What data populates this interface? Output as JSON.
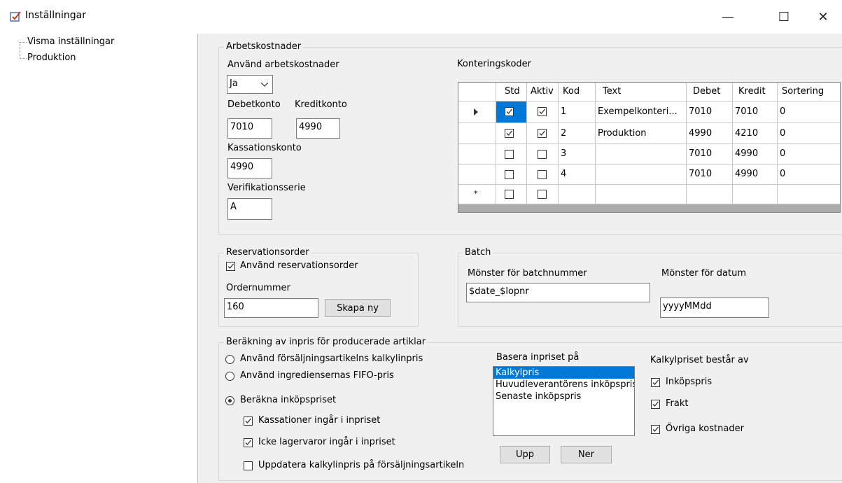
{
  "window": {
    "title": "Inställningar",
    "minimize": "—",
    "maximize": "☐",
    "close": "✕"
  },
  "tree": {
    "items": [
      {
        "label": "Visma inställningar"
      },
      {
        "label": "Produktion"
      }
    ]
  },
  "arbetskostnader": {
    "group_label": "Arbetskostnader",
    "use_label": "Använd arbetskostnader",
    "use_value": "Ja",
    "debet_label": "Debetkonto",
    "kredit_label": "Kreditkonto",
    "debet_value": "7010",
    "kredit_value": "4990",
    "kassation_label": "Kassationskonto",
    "kassation_value": "4990",
    "verif_label": "Verifikationsserie",
    "verif_value": "A"
  },
  "konteringskoder": {
    "label": "Konteringskoder",
    "columns": [
      "Std",
      "Aktiv",
      "Kod",
      "Text",
      "Debet",
      "Kredit",
      "Sortering"
    ],
    "rows": [
      {
        "std": true,
        "aktiv": true,
        "kod": "1",
        "text": "Exempelkonteri...",
        "debet": "7010",
        "kredit": "7010",
        "sortering": "0"
      },
      {
        "std": true,
        "aktiv": true,
        "kod": "2",
        "text": "Produktion",
        "debet": "4990",
        "kredit": "4210",
        "sortering": "0"
      },
      {
        "std": false,
        "aktiv": false,
        "kod": "3",
        "text": "",
        "debet": "7010",
        "kredit": "4990",
        "sortering": "0"
      },
      {
        "std": false,
        "aktiv": false,
        "kod": "4",
        "text": "",
        "debet": "7010",
        "kredit": "4990",
        "sortering": "0"
      }
    ],
    "new_row_marker": "*"
  },
  "reservation": {
    "group_label": "Reservationsorder",
    "use_label": "Använd reservationsorder",
    "use_checked": true,
    "order_label": "Ordernummer",
    "order_value": "160",
    "create_button": "Skapa ny"
  },
  "batch": {
    "group_label": "Batch",
    "pattern_label": "Mönster för batchnummer",
    "pattern_value": "$date_$lopnr",
    "date_label": "Mönster för datum",
    "date_value": "yyyyMMdd"
  },
  "berakning": {
    "group_label": "Beräkning av inpris för producerade artiklar",
    "radio1": "Använd försäljningsartikelns kalkylinpris",
    "radio2": "Använd ingrediensernas FIFO-pris",
    "radio3": "Beräkna inköpspriset",
    "selected_radio": 3,
    "chk1": "Kassationer ingår i inpriset",
    "chk2": "Icke lagervaror ingår i inpriset",
    "chk3": "Uppdatera kalkylinpris på försäljningsartikeln",
    "chk1_checked": true,
    "chk2_checked": true,
    "chk3_checked": false,
    "basera_label": "Basera inpriset på",
    "basera_items": [
      "Kalkylpris",
      "Huvudleverantörens inköpspris",
      "Senaste inköpspris"
    ],
    "basera_selected": 0,
    "upp_button": "Upp",
    "ner_button": "Ner",
    "kalkyl_label": "Kalkylpriset består av",
    "kalkyl_items": [
      {
        "label": "Inköpspris",
        "checked": true
      },
      {
        "label": "Frakt",
        "checked": true
      },
      {
        "label": "Övriga kostnader",
        "checked": true
      }
    ]
  }
}
